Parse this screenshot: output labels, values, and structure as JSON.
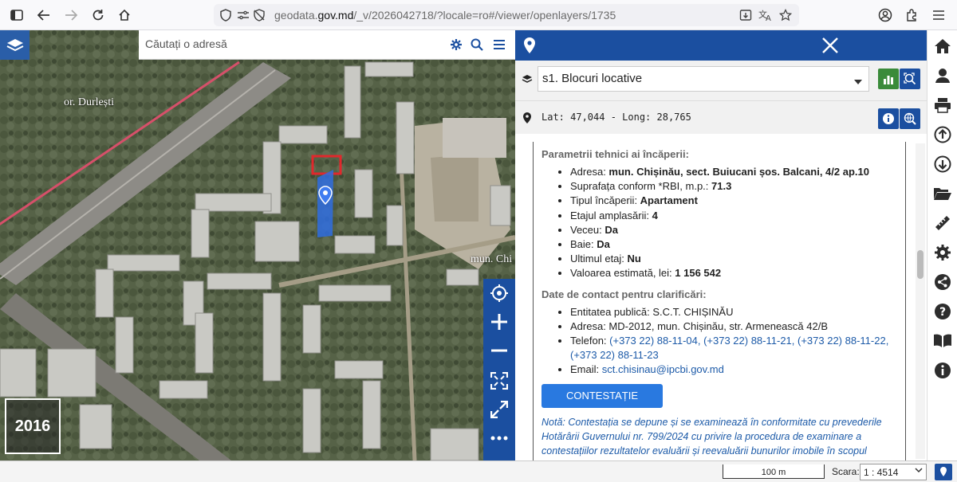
{
  "browser": {
    "url_prefix": "geodata.",
    "url_domain": "gov.md",
    "url_path": "/_v/2026042718/?locale=ro#/viewer/openlayers/1735"
  },
  "map": {
    "search_placeholder": "Căutați o adresă",
    "place_label_1": "or. Durlești",
    "place_label_2": "mun. Chi",
    "year": "2016",
    "colors": {
      "toolbar_blue": "#1b4fa0",
      "marker_blue": "#2f6de0",
      "highlight_red": "#e0282c"
    }
  },
  "panel": {
    "layer_name": "s1. Blocuri locative",
    "coordinates": "Lat: 47,044 - Long: 28,765",
    "tech_title": "Parametrii tehnici ai încăperii:",
    "tech_items": [
      {
        "label": "Adresa: ",
        "value": "mun. Chișinău, sect. Buiucani șos. Balcani, 4/2 ap.10"
      },
      {
        "label": "Suprafața conform *RBI, m.p.: ",
        "value": "71.3"
      },
      {
        "label": "Tipul încăperii: ",
        "value": "Apartament"
      },
      {
        "label": "Etajul amplasării: ",
        "value": "4"
      },
      {
        "label": "Veceu: ",
        "value": "Da"
      },
      {
        "label": "Baie: ",
        "value": "Da"
      },
      {
        "label": "Ultimul etaj: ",
        "value": "Nu"
      },
      {
        "label": "Valoarea estimată, lei: ",
        "value": "1 156 542"
      }
    ],
    "contact_title": "Date de contact pentru clarificări:",
    "contact": {
      "entity": "Entitatea publică: S.C.T. CHIȘINĂU",
      "address": "Adresa: MD-2012, mun. Chișinău, str. Armenească 42/B",
      "phone_label": "Telefon: ",
      "phones": "(+373 22) 88-11-04, (+373 22) 88-11-21, (+373 22) 88-11-22, (+373 22) 88-11-23",
      "email_label": "Email: ",
      "email": "sct.chisinau@ipcbi.gov.md"
    },
    "contest_button": "CONTESTAȚIE",
    "note": "Notă: Contestația se depune și se examinează în conformitate cu prevederile Hotărârii Guvernului nr. 799/2024 cu privire la procedura de examinare a contestațiilor rezultatelor evaluării și reevaluării bunurilor imobile în scopul"
  },
  "status": {
    "scale_bar": "100 m",
    "scale_label": "Scara:",
    "scale_value": "1 : 4514"
  }
}
